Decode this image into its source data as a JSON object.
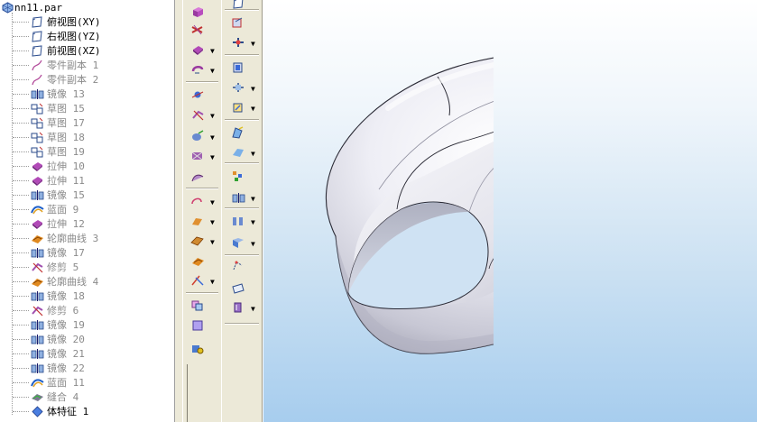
{
  "tree": {
    "root": "nn11.par",
    "items": [
      {
        "label": "俯视图(XY)",
        "icon": "plane-icon",
        "state": "active"
      },
      {
        "label": "右视图(YZ)",
        "icon": "plane-icon",
        "state": "active"
      },
      {
        "label": "前视图(XZ)",
        "icon": "plane-icon",
        "state": "active"
      },
      {
        "label": "零件副本 1",
        "icon": "part-copy-icon",
        "state": "inactive"
      },
      {
        "label": "零件副本 2",
        "icon": "part-copy-icon",
        "state": "inactive"
      },
      {
        "label": "镜像 13",
        "icon": "mirror-icon",
        "state": "inactive"
      },
      {
        "label": "草图 15",
        "icon": "sketch-icon",
        "state": "inactive"
      },
      {
        "label": "草图 17",
        "icon": "sketch-icon",
        "state": "inactive"
      },
      {
        "label": "草图 18",
        "icon": "sketch-icon",
        "state": "inactive"
      },
      {
        "label": "草图 19",
        "icon": "sketch-icon",
        "state": "inactive"
      },
      {
        "label": "拉伸 10",
        "icon": "extrude-icon",
        "state": "inactive"
      },
      {
        "label": "拉伸 11",
        "icon": "extrude-icon",
        "state": "inactive"
      },
      {
        "label": "镜像 15",
        "icon": "mirror-icon",
        "state": "inactive"
      },
      {
        "label": "蓝面 9",
        "icon": "bluesurf-icon",
        "state": "inactive"
      },
      {
        "label": "拉伸 12",
        "icon": "extrude-icon",
        "state": "inactive"
      },
      {
        "label": "轮廓曲线 3",
        "icon": "swept-icon",
        "state": "inactive"
      },
      {
        "label": "镜像 17",
        "icon": "mirror-icon",
        "state": "inactive"
      },
      {
        "label": "修剪 5",
        "icon": "trim-icon",
        "state": "inactive"
      },
      {
        "label": "轮廓曲线 4",
        "icon": "swept-icon",
        "state": "inactive"
      },
      {
        "label": "镜像 18",
        "icon": "mirror-icon",
        "state": "inactive"
      },
      {
        "label": "修剪 6",
        "icon": "trim-icon",
        "state": "inactive"
      },
      {
        "label": "镜像 19",
        "icon": "mirror-icon",
        "state": "inactive"
      },
      {
        "label": "镜像 20",
        "icon": "mirror-icon",
        "state": "inactive"
      },
      {
        "label": "镜像 21",
        "icon": "mirror-icon",
        "state": "inactive"
      },
      {
        "label": "镜像 22",
        "icon": "mirror-icon",
        "state": "inactive"
      },
      {
        "label": "蓝面 11",
        "icon": "bluesurf-icon",
        "state": "inactive"
      },
      {
        "label": "缝合 4",
        "icon": "stitch-icon",
        "state": "inactive"
      },
      {
        "label": "体特征 1",
        "icon": "body-feature-icon",
        "state": "active"
      }
    ]
  },
  "toolbar1_icons": [
    "box-icon",
    "intersect-icon",
    "extrude-icon",
    "revolve-icon",
    "sphere-icon",
    "trim-icon",
    "sweep-icon",
    "blend-icon",
    "loft-icon",
    "curve-icon",
    "arc-icon",
    "surface-icon",
    "swept-icon",
    "split-icon",
    "copy-icon",
    "cube-icon",
    "lock-icon"
  ],
  "toolbar2_icons": [
    "plane-icon",
    "normal-icon",
    "axis-icon",
    "offset-icon",
    "move-icon",
    "rotate-icon",
    "fillet-icon",
    "chamfer-icon",
    "pattern-icon",
    "mirror-icon",
    "rib-icon",
    "thin-wall-icon",
    "keypoint-icon",
    "rectangle-icon",
    "thicken-icon"
  ],
  "colors": {
    "viewport_top": "#ffffff",
    "viewport_bottom": "#a7cdee",
    "inactive_text": "#8a8a8a",
    "toolbar_bg": "#ece9d8",
    "model_light": "#f7f7fb",
    "model_dark": "#a8a8b8"
  }
}
